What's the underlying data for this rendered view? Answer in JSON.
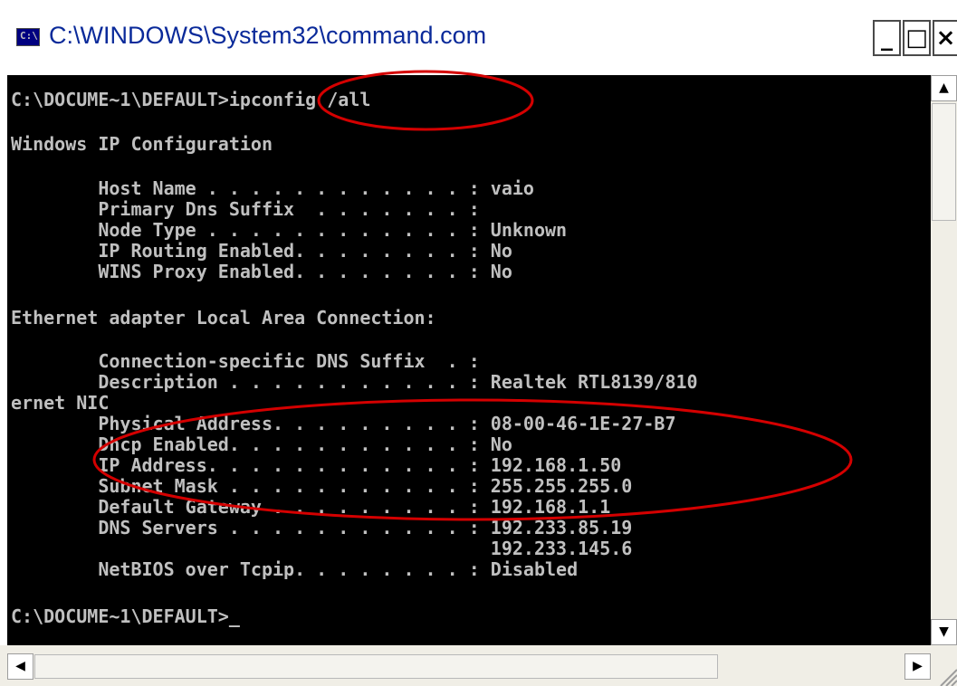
{
  "window": {
    "title": "C:\\WINDOWS\\System32\\command.com",
    "icon_name": "console-window-icon",
    "icon_text": "C:\\",
    "minimize_glyph": "_",
    "maximize_glyph": "□",
    "close_glyph": "×"
  },
  "console": {
    "background": "#000000",
    "text_color": "#c0c0c0",
    "lines": [
      "C:\\DOCUME~1\\DEFAULT>ipconfig /all",
      "Windows IP Configuration",
      "        Host Name . . . . . . . . . . . . : vaio",
      "        Primary Dns Suffix  . . . . . . . :",
      "        Node Type . . . . . . . . . . . . : Unknown",
      "        IP Routing Enabled. . . . . . . . : No",
      "        WINS Proxy Enabled. . . . . . . . : No",
      "Ethernet adapter Local Area Connection:",
      "        Connection-specific DNS Suffix  . :",
      "        Description . . . . . . . . . . . : Realtek RTL8139/810",
      "ernet NIC",
      "        Physical Address. . . . . . . . . : 08-00-46-1E-27-B7",
      "        Dhcp Enabled. . . . . . . . . . . : No",
      "        IP Address. . . . . . . . . . . . : 192.168.1.50",
      "        Subnet Mask . . . . . . . . . . . : 255.255.255.0",
      "        Default Gateway . . . . . . . . . : 192.168.1.1",
      "        DNS Servers . . . . . . . . . . . : 192.233.85.19",
      "                                            192.233.145.6",
      "        NetBIOS over Tcpip. . . . . . . . : Disabled",
      "C:\\DOCUME~1\\DEFAULT>_"
    ]
  },
  "annotations": {
    "color": "#d40000"
  },
  "scrollbars": {
    "up_glyph": "▲",
    "down_glyph": "▼",
    "left_glyph": "◀",
    "right_glyph": "▶"
  }
}
